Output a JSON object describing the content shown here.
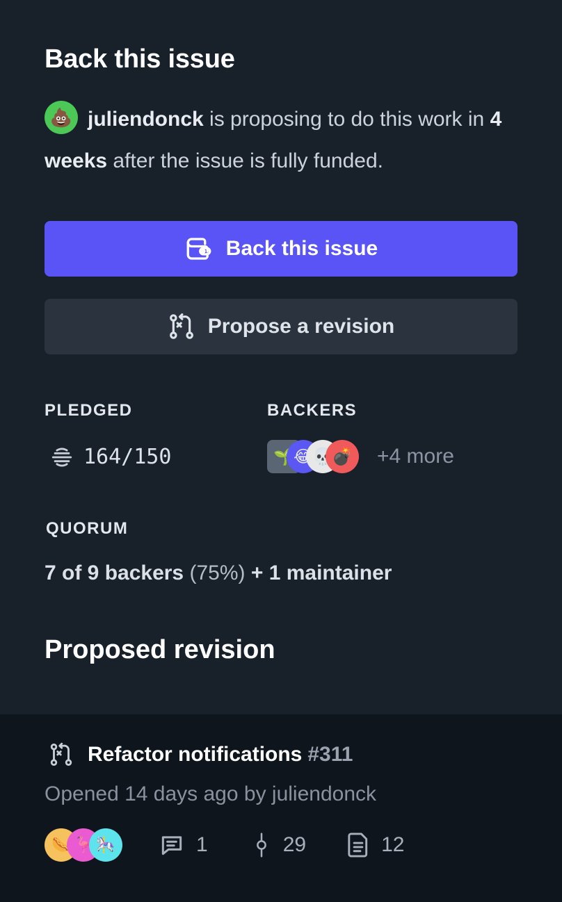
{
  "header": {
    "title": "Back this issue"
  },
  "proposal": {
    "avatar_emoji": "💩",
    "user": "juliendonck",
    "text1": " is proposing to do this work in ",
    "duration": "4 weeks",
    "text2": " after the issue is fully funded."
  },
  "actions": {
    "back_label": "Back this issue",
    "revise_label": "Propose a revision"
  },
  "stats": {
    "pledged_label": "PLEDGED",
    "pledged_value": "164/150",
    "backers_label": "BACKERS",
    "backers_more": "+4 more",
    "backer_avatars": [
      "🌱",
      "😂",
      "💀",
      "💣"
    ]
  },
  "quorum": {
    "label": "QUORUM",
    "backers": "7 of 9 backers",
    "percent": "(75%)",
    "maintainer": "+ 1 maintainer"
  },
  "revision": {
    "title": "Proposed revision",
    "pr_title": "Refactor notifications",
    "pr_number": "#311",
    "meta": "Opened 14 days ago by juliendonck",
    "comments": "1",
    "commits": "29",
    "files": "12",
    "avatars": [
      "🌭",
      "🦩",
      "🎠"
    ]
  },
  "colors": {
    "background": "#18202a",
    "card": "#0e151d",
    "primary": "#5a54f7",
    "secondary": "#2b333e"
  }
}
